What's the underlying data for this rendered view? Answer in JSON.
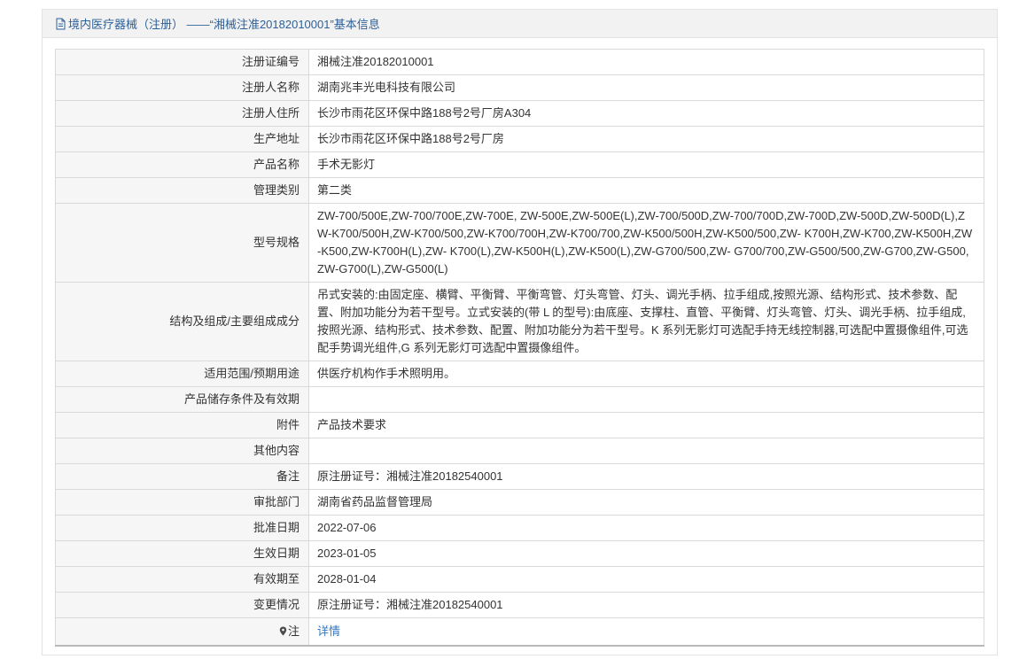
{
  "header": {
    "icon": "document-icon",
    "title": "境内医疗器械（注册） ——“湘械注准20182010001”基本信息"
  },
  "rows": [
    {
      "label": "注册证编号",
      "value": "湘械注准20182010001"
    },
    {
      "label": "注册人名称",
      "value": "湖南兆丰光电科技有限公司"
    },
    {
      "label": "注册人住所",
      "value": "长沙市雨花区环保中路188号2号厂房A304"
    },
    {
      "label": "生产地址",
      "value": "长沙市雨花区环保中路188号2号厂房"
    },
    {
      "label": "产品名称",
      "value": "手术无影灯"
    },
    {
      "label": "管理类别",
      "value": "第二类"
    },
    {
      "label": "型号规格",
      "value": "ZW-700/500E,ZW-700/700E,ZW-700E, ZW-500E,ZW-500E(L),ZW-700/500D,ZW-700/700D,ZW-700D,ZW-500D,ZW-500D(L),ZW-K700/500H,ZW-K700/500,ZW-K700/700H,ZW-K700/700,ZW-K500/500H,ZW-K500/500,ZW- K700H,ZW-K700,ZW-K500H,ZW-K500,ZW-K700H(L),ZW- K700(L),ZW-K500H(L),ZW-K500(L),ZW-G700/500,ZW- G700/700,ZW-G500/500,ZW-G700,ZW-G500,ZW-G700(L),ZW-G500(L)"
    },
    {
      "label": "结构及组成/主要组成成分",
      "value": "吊式安装的:由固定座、横臂、平衡臂、平衡弯管、灯头弯管、灯头、调光手柄、拉手组成,按照光源、结构形式、技术参数、配置、附加功能分为若干型号。立式安装的(带 L 的型号):由底座、支撑柱、直管、平衡臂、灯头弯管、灯头、调光手柄、拉手组成,按照光源、结构形式、技术参数、配置、附加功能分为若干型号。K 系列无影灯可选配手持无线控制器,可选配中置摄像组件,可选配手势调光组件,G 系列无影灯可选配中置摄像组件。"
    },
    {
      "label": "适用范围/预期用途",
      "value": "供医疗机构作手术照明用。"
    },
    {
      "label": "产品储存条件及有效期",
      "value": ""
    },
    {
      "label": "附件",
      "value": "产品技术要求"
    },
    {
      "label": "其他内容",
      "value": ""
    },
    {
      "label": "备注",
      "value": "原注册证号：湘械注准20182540001"
    },
    {
      "label": "审批部门",
      "value": "湖南省药品监督管理局"
    },
    {
      "label": "批准日期",
      "value": "2022-07-06"
    },
    {
      "label": "生效日期",
      "value": "2023-01-05"
    },
    {
      "label": "有效期至",
      "value": "2028-01-04"
    },
    {
      "label": "变更情况",
      "value": "原注册证号：湘械注准20182540001"
    }
  ],
  "note_row": {
    "icon": "marker-icon",
    "label": "注",
    "link": "详情"
  },
  "theme": {
    "header_text": "#2d6099",
    "link": "#3277c0",
    "label_bg": "#f6f6f6",
    "header_bg": "#f2f2f2",
    "border": "#d9d9d9"
  }
}
